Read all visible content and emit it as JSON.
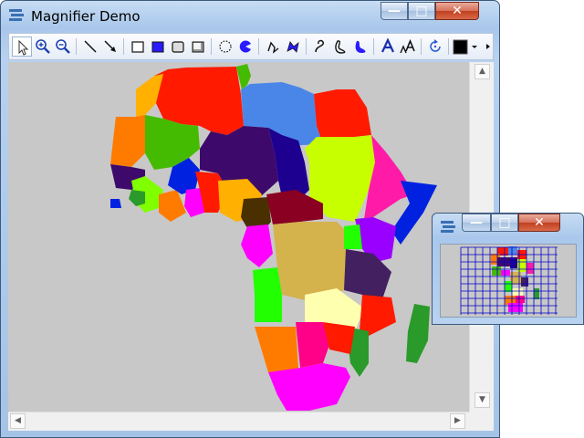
{
  "window": {
    "title": "Magnifier Demo",
    "minimize_glyph": "—",
    "maximize_glyph": "□",
    "close_glyph": "✕"
  },
  "toolbar": {
    "tools": [
      {
        "name": "pointer-tool"
      },
      {
        "name": "zoom-in-tool"
      },
      {
        "name": "zoom-out-tool"
      },
      {
        "name": "line-tool"
      },
      {
        "name": "arrow-tool"
      },
      {
        "name": "rectangle-tool"
      },
      {
        "name": "filled-rectangle-tool"
      },
      {
        "name": "rounded-rectangle-tool"
      },
      {
        "name": "shaded-rectangle-tool"
      },
      {
        "name": "ellipse-tool"
      },
      {
        "name": "pie-tool"
      },
      {
        "name": "polyline-tool"
      },
      {
        "name": "polygon-tool"
      },
      {
        "name": "curve-tool"
      },
      {
        "name": "closed-curve-tool"
      },
      {
        "name": "filled-curve-tool"
      },
      {
        "name": "text-tool"
      },
      {
        "name": "outlined-text-tool"
      },
      {
        "name": "rotate-tool"
      },
      {
        "name": "color-picker"
      }
    ],
    "current_color": "#000000"
  },
  "map": {
    "background": "#c8c8c8",
    "region_colors": [
      "#ff1a00",
      "#4a86e8",
      "#ffb000",
      "#ff7b00",
      "#44bb00",
      "#3d0a6b",
      "#1e0090",
      "#c7ff00",
      "#ff1aa8",
      "#0022e0",
      "#8a0022",
      "#7a3b00",
      "#d4b24c",
      "#9a00ff",
      "#432060",
      "#ff00ff",
      "#22ff00",
      "#ffffb0",
      "#2a9a2a",
      "#ff0088",
      "#7fff00"
    ]
  },
  "magnifier": {
    "minimize_glyph": "—",
    "maximize_glyph": "□",
    "close_glyph": "✕",
    "grid_color": "#0000cc"
  }
}
